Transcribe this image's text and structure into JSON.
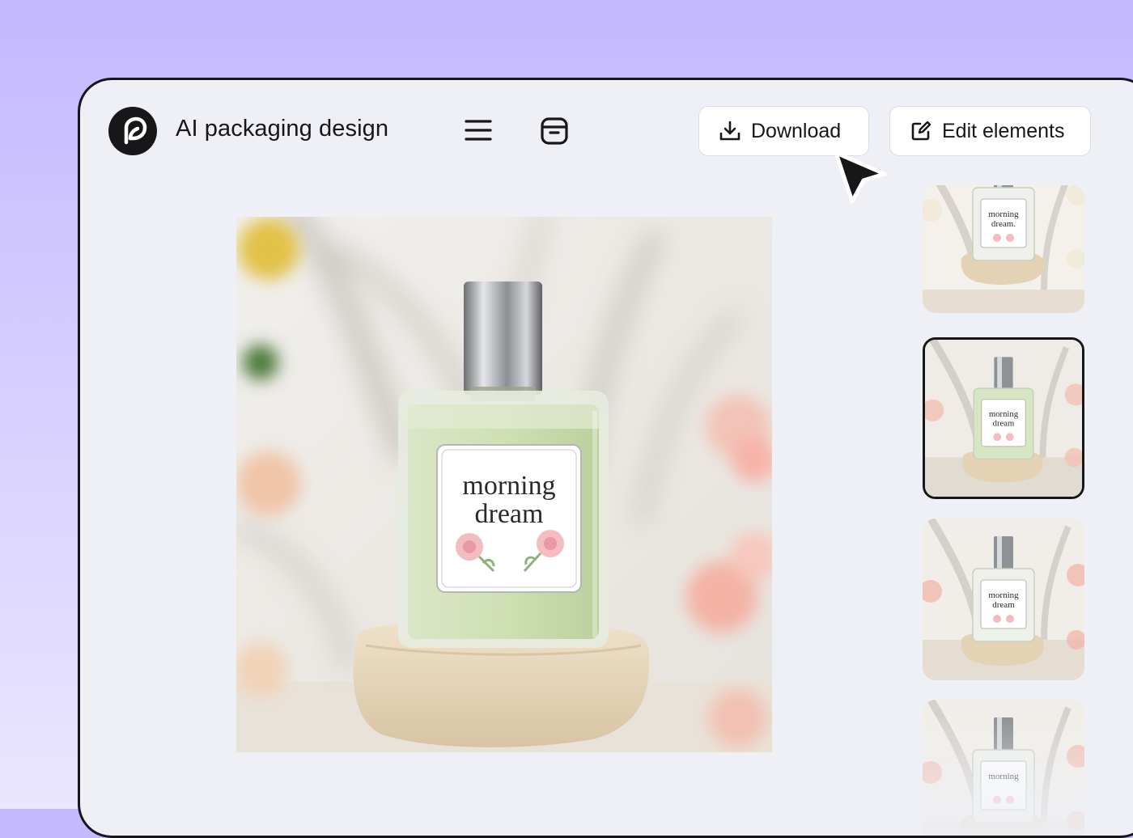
{
  "app": {
    "title": "AI packaging design"
  },
  "toolbar": {
    "download_label": "Download",
    "edit_label": "Edit elements"
  },
  "icons": {
    "logo": "leaf-logo-icon",
    "menu": "hamburger-menu-icon",
    "archive": "archive-box-icon",
    "download": "download-icon",
    "edit": "edit-square-icon",
    "cursor": "mouse-pointer-icon"
  },
  "preview": {
    "label_line1": "morning",
    "label_line2": "dream"
  },
  "thumbnails": [
    {
      "label_line1": "morning",
      "label_line2": "dream.",
      "selected": false
    },
    {
      "label_line1": "morning",
      "label_line2": "dream",
      "selected": true
    },
    {
      "label_line1": "morning",
      "label_line2": "dream",
      "selected": false
    },
    {
      "label_line1": "morning",
      "label_line2": "",
      "selected": false
    }
  ],
  "colors": {
    "background": "#c4b8ff",
    "window": "#eef0f6",
    "ink": "#17171a",
    "bottle_green": "#cfe0b3",
    "rose": "#f1b9b6"
  }
}
